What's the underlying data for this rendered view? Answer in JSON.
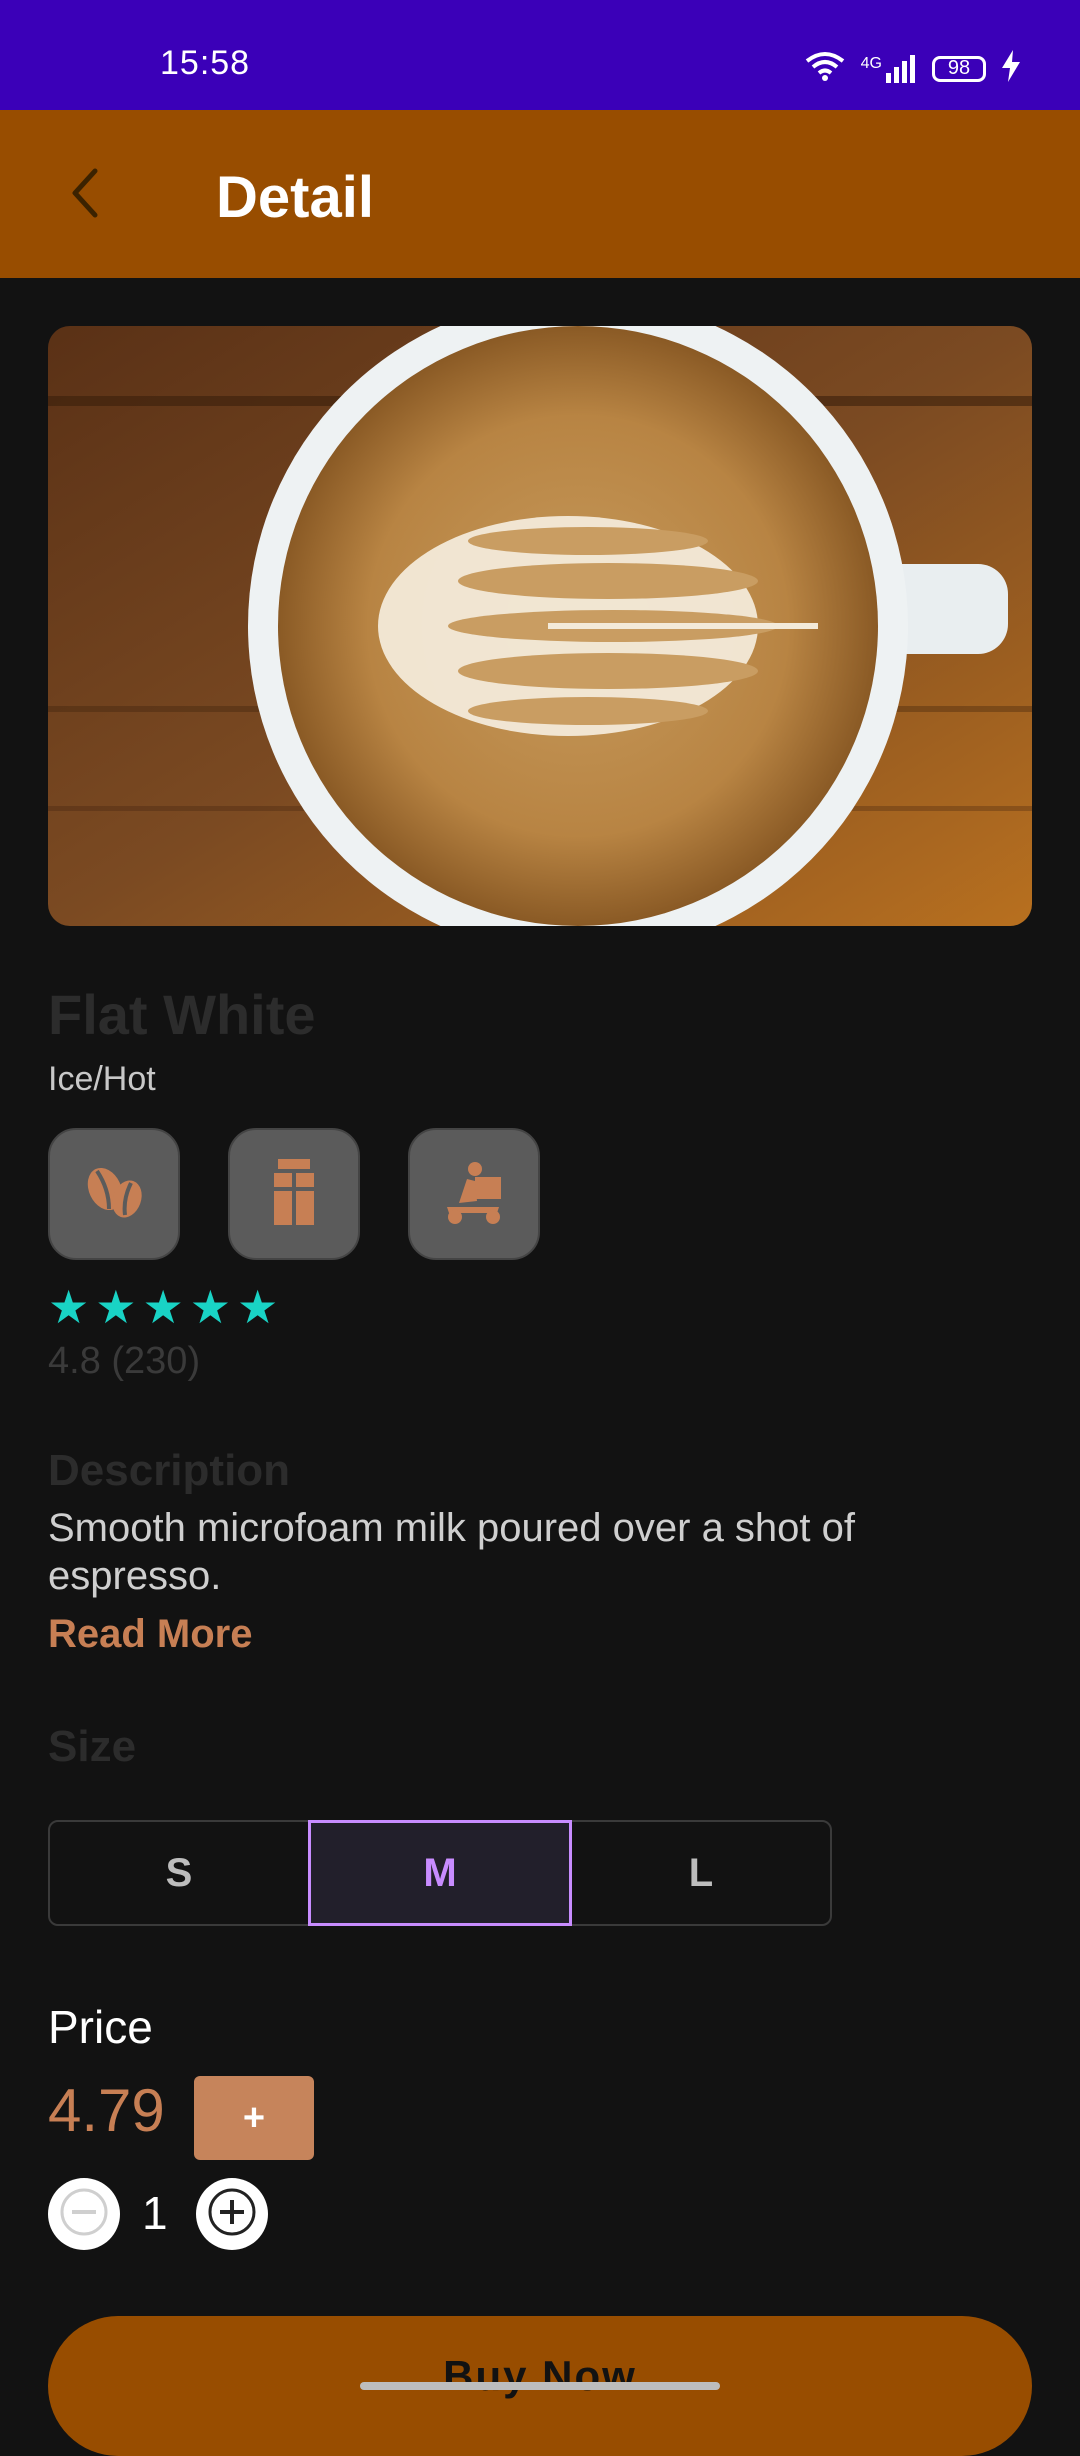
{
  "status_bar": {
    "time": "15:58",
    "network": "4G",
    "battery": "98"
  },
  "app_bar": {
    "title": "Detail"
  },
  "product": {
    "name": "Flat White",
    "subtitle": "Ice/Hot",
    "features": [
      {
        "icon": "coffee-beans-icon"
      },
      {
        "icon": "milk-carton-icon"
      },
      {
        "icon": "delivery-scooter-icon"
      }
    ],
    "rating_stars": 5,
    "rating_text": "4.8 (230)"
  },
  "description": {
    "heading": "Description",
    "text": "Smooth microfoam milk poured over a shot of espresso.",
    "read_more": "Read More"
  },
  "size": {
    "heading": "Size",
    "options": [
      "S",
      "M",
      "L"
    ],
    "selected": "M"
  },
  "price": {
    "label": "Price",
    "value": "4.79",
    "add_label": "+",
    "quantity": "1"
  },
  "buy": {
    "label": "Buy Now"
  },
  "colors": {
    "status_bar": "#3b00b8",
    "app_bar": "#984d00",
    "accent": "#c77f54",
    "star": "#19d3c5",
    "selected_size": "#c88cff"
  }
}
